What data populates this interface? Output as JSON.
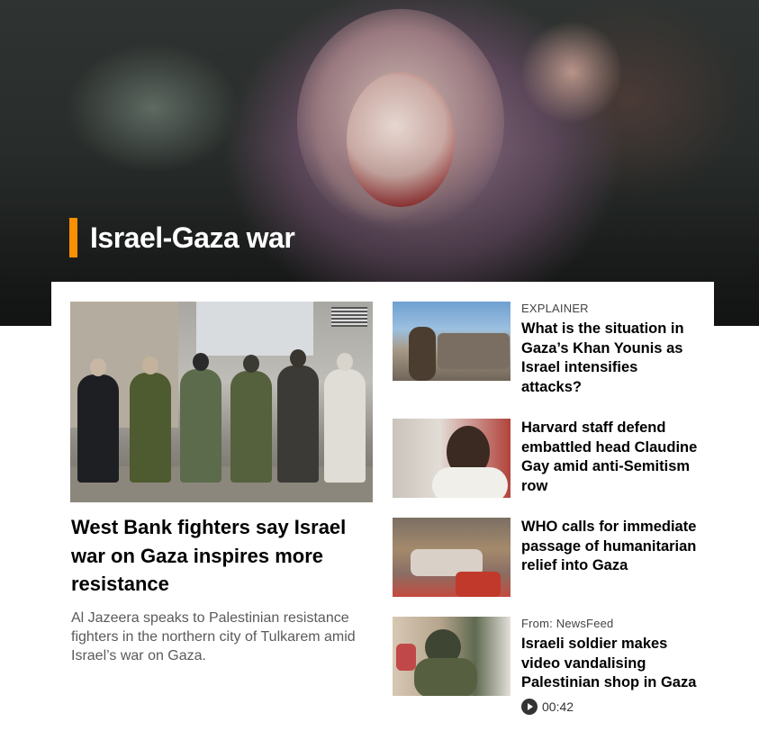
{
  "hero": {
    "section_title": "Israel-Gaza war",
    "accent_color": "#fa9000"
  },
  "lead_story": {
    "title": "West Bank fighters say Israel war on Gaza inspires more resistance",
    "summary": "Al Jazeera speaks to Palestinian resistance fighters in the northern city of Tulkarem amid Israel’s war on Gaza."
  },
  "side_stories": [
    {
      "kicker": "EXPLAINER",
      "title": "What is the situation in Gaza’s Khan Younis as Israel intensifies attacks?"
    },
    {
      "kicker": "",
      "title": "Harvard staff defend embattled head Claudine Gay amid anti-Semitism row"
    },
    {
      "kicker": "",
      "title": "WHO calls for immediate passage of humanitarian relief into Gaza"
    },
    {
      "kicker": "From: NewsFeed",
      "title": "Israeli soldier makes video vandalising Palestinian shop in Gaza",
      "duration": "00:42",
      "icon": "play-icon"
    }
  ]
}
